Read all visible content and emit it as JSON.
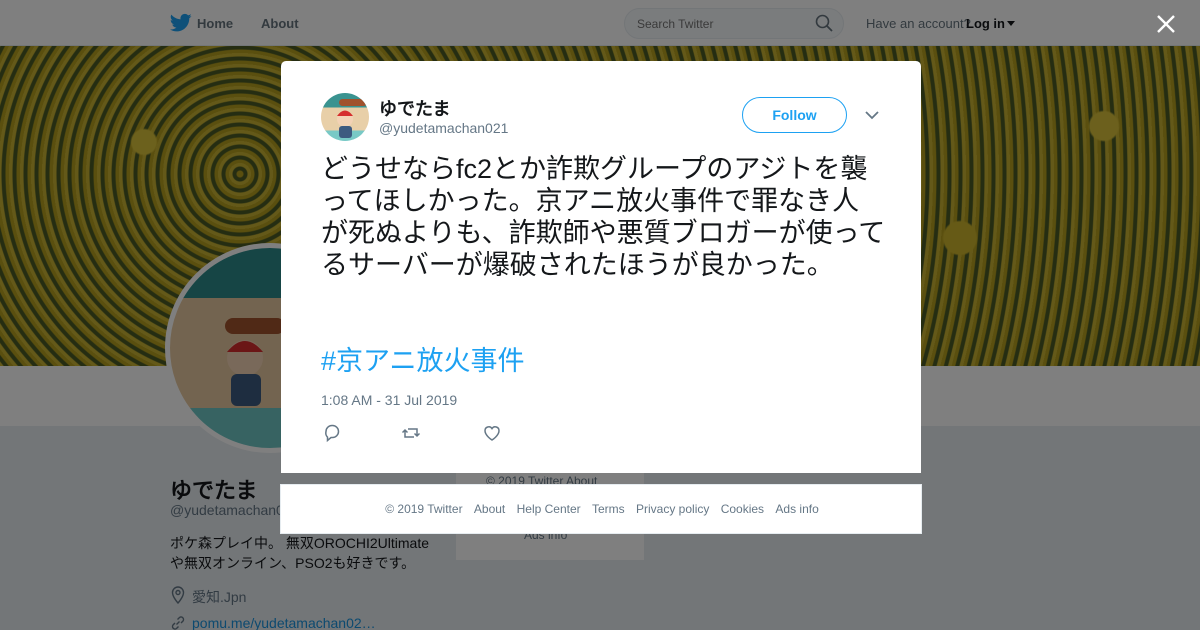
{
  "header": {
    "nav": {
      "home": "Home",
      "about": "About"
    },
    "search_placeholder": "Search Twitter",
    "account_prompt": "Have an account?",
    "login": "Log in"
  },
  "profile": {
    "name": "ゆでたま",
    "handle": "@yudetamachan0",
    "bio": "ポケ森プレイ中。 無双OROCHI2Ultimateや無双オンライン、PSO2も好きです。",
    "location": "愛知.Jpn",
    "link": "pomu.me/yudetamachan02…"
  },
  "sidebar": {
    "line1": "© 2019 Twitter   About",
    "line2": "Ads info"
  },
  "tweet": {
    "display_name": "ゆでたま",
    "screen_name": "@yudetamachan021",
    "follow_label": "Follow",
    "text": "どうせならfc2とか詐欺グループのアジトを襲ってほしかった。京アニ放火事件で罪なき人が死ぬよりも、詐欺師や悪質ブロガーが使ってるサーバーが爆破されたほうが良かった。",
    "hashtag": "#京アニ放火事件",
    "timestamp": "1:08 AM - 31 Jul 2019"
  },
  "footer": {
    "copyright": "© 2019 Twitter",
    "links": [
      "About",
      "Help Center",
      "Terms",
      "Privacy policy",
      "Cookies",
      "Ads info"
    ]
  },
  "colors": {
    "brand": "#1da1f2",
    "link": "#1b95e0",
    "overlay": "rgba(0,0,0,0.5)"
  },
  "icons": [
    "twitter-bird-icon",
    "search-icon",
    "close-icon",
    "chevron-down-icon",
    "reply-icon",
    "retweet-icon",
    "like-icon",
    "location-icon",
    "link-icon"
  ]
}
